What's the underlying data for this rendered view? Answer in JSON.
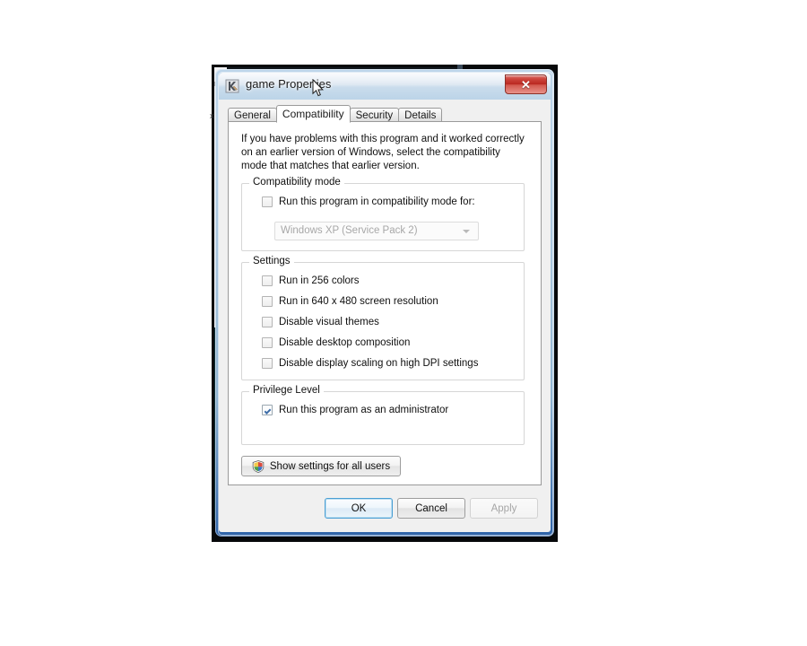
{
  "window": {
    "title": "game Properties",
    "app_icon": "app-k-icon",
    "close_label": "✕"
  },
  "tabs": [
    {
      "label": "General",
      "selected": false
    },
    {
      "label": "Compatibility",
      "selected": true
    },
    {
      "label": "Security",
      "selected": false
    },
    {
      "label": "Details",
      "selected": false
    }
  ],
  "page": {
    "intro": "If you have problems with this program and it worked correctly on an earlier version of Windows, select the compatibility mode that matches that earlier version.",
    "compatibility_mode": {
      "legend": "Compatibility mode",
      "checkbox": {
        "label": "Run this program in compatibility mode for:",
        "checked": false
      },
      "combo": {
        "value": "Windows XP (Service Pack 2)",
        "disabled": true
      }
    },
    "settings": {
      "legend": "Settings",
      "items": [
        {
          "label": "Run in 256 colors",
          "checked": false
        },
        {
          "label": "Run in 640 x 480 screen resolution",
          "checked": false
        },
        {
          "label": "Disable visual themes",
          "checked": false
        },
        {
          "label": "Disable desktop composition",
          "checked": false
        },
        {
          "label": "Disable display scaling on high DPI settings",
          "checked": false
        }
      ]
    },
    "privilege_level": {
      "legend": "Privilege Level",
      "checkbox": {
        "label": "Run this program as an administrator",
        "checked": true
      }
    },
    "show_all_users": {
      "label": "Show settings for all users",
      "icon": "uac-shield-icon"
    }
  },
  "footer": {
    "ok": "OK",
    "cancel": "Cancel",
    "apply": "Apply",
    "apply_disabled": true
  },
  "background": {
    "glyph_1": "r",
    "glyph_2": "x"
  },
  "colors": {
    "accent": "#2e63a8",
    "title_gradient_top": "#e9eff6",
    "close_red": "#b92820",
    "check_blue": "#3d6da8",
    "dialog_bg": "#f0f0f0",
    "page_bg": "#ffffff",
    "groupbox_border": "#d6d6d6",
    "disabled_text": "#a8a8a8"
  }
}
